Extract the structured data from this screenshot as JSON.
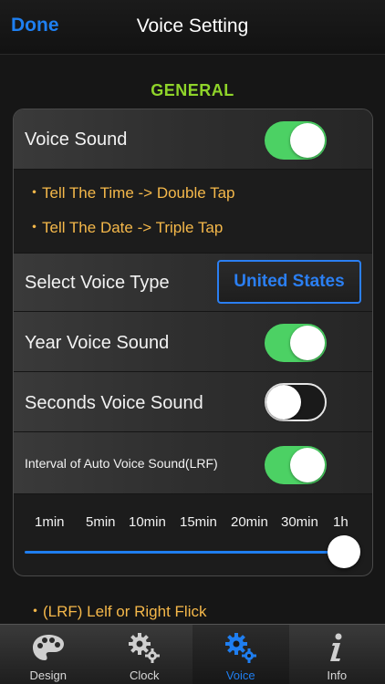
{
  "nav": {
    "done_label": "Done",
    "title": "Voice Setting"
  },
  "section": {
    "title": "GENERAL"
  },
  "rows": {
    "voice_sound": {
      "label": "Voice Sound",
      "on": true
    },
    "tip_time": "・Tell The Time -> Double Tap",
    "tip_date": "・Tell The Date -> Triple Tap",
    "voice_type": {
      "label": "Select Voice Type",
      "value": "United States"
    },
    "year_voice": {
      "label": "Year Voice Sound",
      "on": true
    },
    "seconds_voice": {
      "label": "Seconds Voice Sound",
      "on": false
    },
    "interval_voice": {
      "label": "Interval of Auto Voice Sound(LRF)",
      "on": true
    }
  },
  "slider": {
    "ticks": [
      "1min",
      "5min",
      "10min",
      "15min",
      "20min",
      "30min",
      "1h"
    ],
    "selected": "1h"
  },
  "footnote": "・(LRF) Lelf or Right Flick",
  "tabs": [
    {
      "label": "Design",
      "icon": "palette-icon",
      "active": false
    },
    {
      "label": "Clock",
      "icon": "gears-icon",
      "active": false
    },
    {
      "label": "Voice",
      "icon": "gears-icon",
      "active": true
    },
    {
      "label": "Info",
      "icon": "info-icon",
      "active": false
    }
  ],
  "colors": {
    "accent_blue": "#1f7ef0",
    "section_green": "#8fd42a",
    "toggle_green": "#4cd164",
    "tip_orange": "#f5b84a"
  }
}
